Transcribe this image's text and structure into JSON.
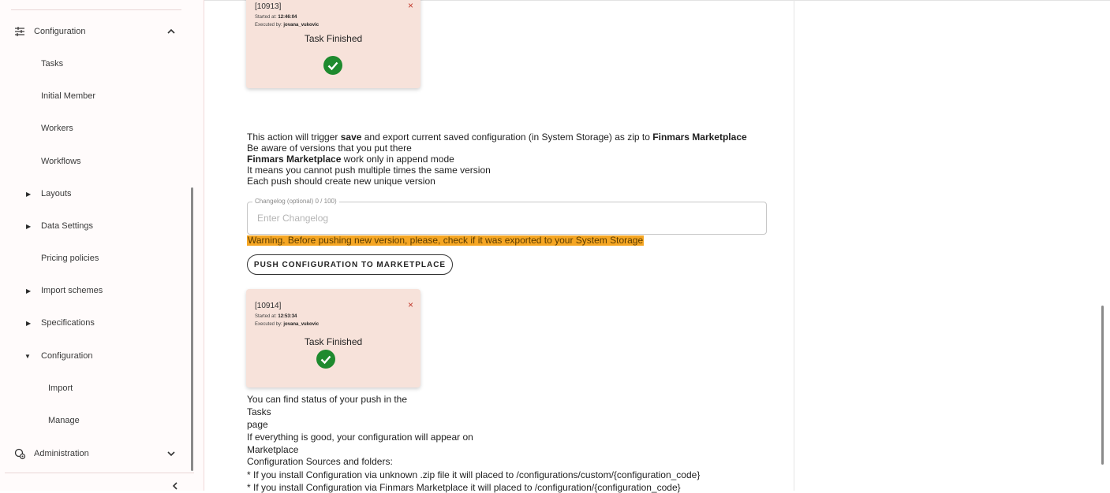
{
  "sidebar": {
    "items": [
      {
        "label": "Configuration",
        "icon": "sliders-icon",
        "state": "expanded"
      },
      {
        "label": "Tasks"
      },
      {
        "label": "Initial Member"
      },
      {
        "label": "Workers"
      },
      {
        "label": "Workflows"
      },
      {
        "label": "Layouts",
        "caret": "collapsed"
      },
      {
        "label": "Data Settings",
        "caret": "collapsed"
      },
      {
        "label": "Pricing policies"
      },
      {
        "label": "Import schemes",
        "caret": "collapsed"
      },
      {
        "label": "Specifications",
        "caret": "collapsed"
      },
      {
        "label": "Configuration",
        "caret": "expanded"
      },
      {
        "label": "Import"
      },
      {
        "label": "Manage"
      },
      {
        "label": "Administration",
        "icon": "admin-gear-icon",
        "state": "collapsed"
      }
    ],
    "collapse_icon": "chevron-left-icon"
  },
  "task_cards": [
    {
      "id": "[10913]",
      "started_label": "Started at:",
      "started_time": "12:46:04",
      "executed_label": "Executed by:",
      "executed_user": "jovana_vukovic",
      "status": "Task Finished",
      "close": "×"
    },
    {
      "id": "[10914]",
      "started_label": "Started at:",
      "started_time": "12:53:34",
      "executed_label": "Executed by:",
      "executed_user": "jovana_vukovic",
      "status": "Task Finished",
      "close": "×"
    }
  ],
  "info": {
    "l1_a": "This action will trigger ",
    "l1_save": "save",
    "l1_b": " and export current saved configuration (in System Storage) as zip to ",
    "l1_market": "Finmars Marketplace",
    "l2": "Be aware of versions that you put there",
    "l3_market": "Finmars Marketplace",
    "l3_b": " work only in append mode",
    "l4": "It means you cannot push multiple times the same version",
    "l5": "Each push should create new unique version"
  },
  "changelog": {
    "label": "Changelog (optional) 0 / 100)",
    "placeholder": "Enter Changelog"
  },
  "warning": "Warning. Before pushing new version, please, check if it was exported to your System Storage",
  "push_button": "PUSH CONFIGURATION TO MARKETPLACE",
  "footer": {
    "f1": "You can find status of your push in the",
    "f2": "Tasks",
    "f3": "page",
    "f4": "If everything is good, your configuration will appear on",
    "f5": "Marketplace",
    "f6": "Configuration Sources and folders:",
    "f7": "* If you install Configuration via unknown .zip file it will placed to /configurations/custom/{configuration_code}",
    "f8": "* If you install Configuration via Finmars Marketplace it will placed to /configuration/{configuration_code}"
  },
  "colors": {
    "accent": "#f7e2da",
    "warning": "#f5a623",
    "success": "#1e8a2e",
    "close": "#c0392b"
  }
}
